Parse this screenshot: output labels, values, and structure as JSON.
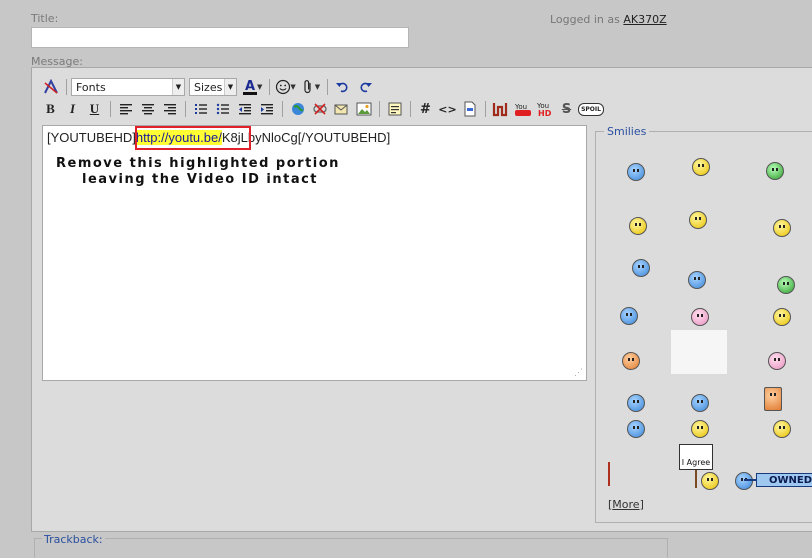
{
  "title_label": "Title:",
  "title_value": "",
  "logged_prefix": "Logged in as",
  "username": "AK370Z",
  "message_label": "Message:",
  "toolbar": {
    "fonts_label": "Fonts",
    "sizes_label": "Sizes",
    "bold": "B",
    "italic": "I",
    "underline": "U",
    "hash": "#",
    "code": "<>",
    "strike": "S",
    "spoil": "SPOIL"
  },
  "editor": {
    "text_before": "[YOUTUBEHD]",
    "highlighted": "http://youtu.be/",
    "text_after": "K8jLbyNloCg[/YOUTUBEHD]",
    "annotation_line1": "Remove this highlighted portion",
    "annotation_line2": "leaving the Video ID intact"
  },
  "smilies": {
    "legend": "Smilies",
    "agree_text": "I Agree",
    "owned_text": "OWNED",
    "more_label": "More"
  },
  "trackback_label": "Trackback:",
  "colors": {
    "page_bg": "#c7c7c7",
    "panel_bg": "#dcdcdc",
    "highlight": "#ffff33",
    "annotation_box": "#e0202a",
    "legend_text": "#2a4fa0"
  }
}
